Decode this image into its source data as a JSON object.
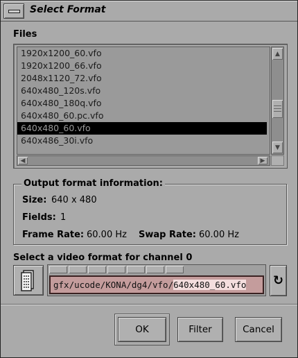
{
  "window": {
    "title": "Select Format"
  },
  "files": {
    "label": "Files",
    "items": [
      "1920x1200_60.vfo",
      "1920x1200_66.vfo",
      "2048x1120_72.vfo",
      "640x480_120s.vfo",
      "640x480_180q.vfo",
      "640x480_60.pc.vfo",
      "640x480_60.vfo",
      "640x486_30i.vfo"
    ],
    "selected": "640x480_60.vfo"
  },
  "output_info": {
    "title": "Output format information:",
    "size_label": "Size:",
    "size_value": "640 x 480",
    "fields_label": "Fields:",
    "fields_value": "1",
    "frame_rate_label": "Frame Rate:",
    "frame_rate_value": "60.00 Hz",
    "swap_rate_label": "Swap Rate:",
    "swap_rate_value": "60.00 Hz"
  },
  "channel": {
    "label": "Select a video format for channel 0",
    "path_prefix": "gfx/ucode/KONA/dg4/vfo/",
    "path_selected": "640x480_60.vfo"
  },
  "buttons": {
    "ok": "OK",
    "filter": "Filter",
    "cancel": "Cancel"
  },
  "icons": {
    "window_menu": "window-menu-icon",
    "file_chooser": "file-chooser-icon",
    "reload": "reload-icon",
    "reload_glyph": "↻"
  }
}
